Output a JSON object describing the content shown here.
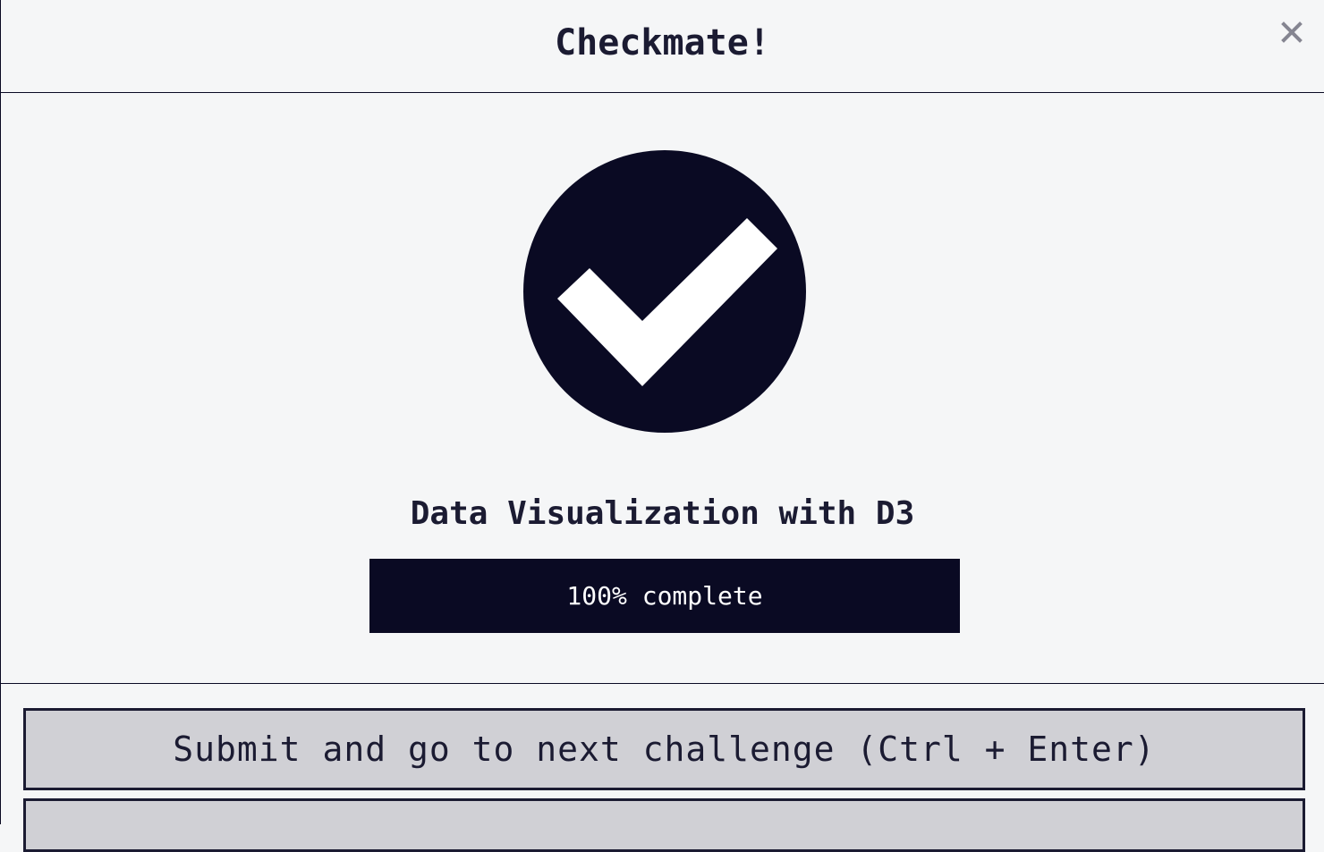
{
  "modal": {
    "title": "Checkmate!",
    "close_icon": "close-icon",
    "close_label": "×"
  },
  "completion": {
    "icon": "check-circle-icon",
    "block_title": "Data Visualization with D3",
    "progress_percent": 100,
    "progress_label": "100% complete"
  },
  "actions": {
    "submit_label": "Submit and go to next challenge (Ctrl + Enter)"
  },
  "colors": {
    "background": "#f5f6f7",
    "dark": "#0a0a23",
    "button_bg": "#d0d0d5",
    "close_icon": "#858591"
  }
}
